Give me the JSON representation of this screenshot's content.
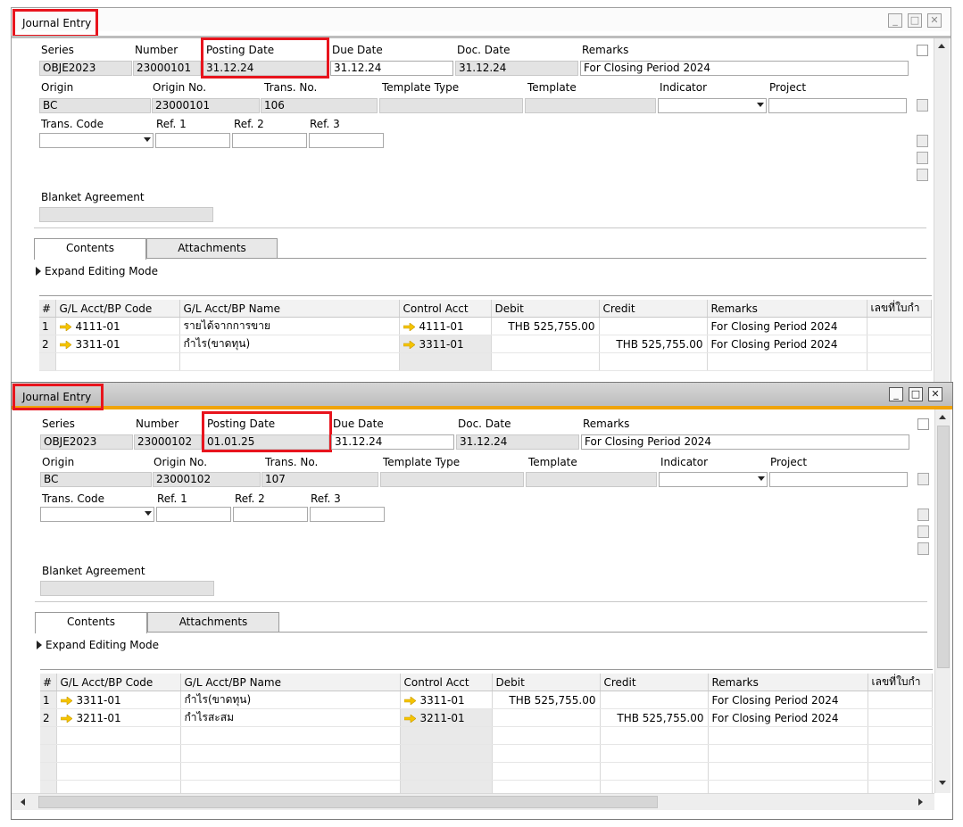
{
  "windows": [
    {
      "title": "Journal Entry",
      "fields": {
        "series": {
          "label": "Series",
          "value": "OBJE2023"
        },
        "number": {
          "label": "Number",
          "value": "23000101"
        },
        "posting_date": {
          "label": "Posting Date",
          "value": "31.12.24"
        },
        "due_date": {
          "label": "Due Date",
          "value": "31.12.24"
        },
        "doc_date": {
          "label": "Doc. Date",
          "value": "31.12.24"
        },
        "remarks": {
          "label": "Remarks",
          "value": "For Closing Period 2024"
        },
        "origin": {
          "label": "Origin",
          "value": "BC"
        },
        "origin_no": {
          "label": "Origin No.",
          "value": "23000101"
        },
        "trans_no": {
          "label": "Trans. No.",
          "value": "106"
        },
        "template_type": {
          "label": "Template Type",
          "value": ""
        },
        "template": {
          "label": "Template",
          "value": ""
        },
        "indicator": {
          "label": "Indicator",
          "value": ""
        },
        "project": {
          "label": "Project",
          "value": ""
        },
        "trans_code": {
          "label": "Trans. Code",
          "value": ""
        },
        "ref1": {
          "label": "Ref. 1",
          "value": ""
        },
        "ref2": {
          "label": "Ref. 2",
          "value": ""
        },
        "ref3": {
          "label": "Ref. 3",
          "value": ""
        },
        "blanket": {
          "label": "Blanket Agreement",
          "value": ""
        }
      },
      "tabs": [
        "Contents",
        "Attachments"
      ],
      "expand_label": "Expand Editing Mode",
      "columns": [
        "#",
        "G/L Acct/BP Code",
        "G/L Acct/BP Name",
        "Control Acct",
        "Debit",
        "Credit",
        "Remarks",
        "เลขที่ใบกำ"
      ],
      "rows": [
        {
          "n": "1",
          "code": "4111-01",
          "name": "รายได้จากการขาย",
          "ctrl": "4111-01",
          "debit": "THB 525,755.00",
          "credit": "",
          "remarks": "For Closing Period 2024"
        },
        {
          "n": "2",
          "code": "3311-01",
          "name": "กำไร(ขาดทุน)",
          "ctrl": "3311-01",
          "debit": "",
          "credit": "THB 525,755.00",
          "remarks": "For Closing Period 2024"
        }
      ]
    },
    {
      "title": "Journal Entry",
      "fields": {
        "series": {
          "label": "Series",
          "value": "OBJE2023"
        },
        "number": {
          "label": "Number",
          "value": "23000102"
        },
        "posting_date": {
          "label": "Posting Date",
          "value": "01.01.25"
        },
        "due_date": {
          "label": "Due Date",
          "value": "31.12.24"
        },
        "doc_date": {
          "label": "Doc. Date",
          "value": "31.12.24"
        },
        "remarks": {
          "label": "Remarks",
          "value": "For Closing Period 2024"
        },
        "origin": {
          "label": "Origin",
          "value": "BC"
        },
        "origin_no": {
          "label": "Origin No.",
          "value": "23000102"
        },
        "trans_no": {
          "label": "Trans. No.",
          "value": "107"
        },
        "template_type": {
          "label": "Template Type",
          "value": ""
        },
        "template": {
          "label": "Template",
          "value": ""
        },
        "indicator": {
          "label": "Indicator",
          "value": ""
        },
        "project": {
          "label": "Project",
          "value": ""
        },
        "trans_code": {
          "label": "Trans. Code",
          "value": ""
        },
        "ref1": {
          "label": "Ref. 1",
          "value": ""
        },
        "ref2": {
          "label": "Ref. 2",
          "value": ""
        },
        "ref3": {
          "label": "Ref. 3",
          "value": ""
        },
        "blanket": {
          "label": "Blanket Agreement",
          "value": ""
        }
      },
      "tabs": [
        "Contents",
        "Attachments"
      ],
      "expand_label": "Expand Editing Mode",
      "columns": [
        "#",
        "G/L Acct/BP Code",
        "G/L Acct/BP Name",
        "Control Acct",
        "Debit",
        "Credit",
        "Remarks",
        "เลขที่ใบกำ"
      ],
      "rows": [
        {
          "n": "1",
          "code": "3311-01",
          "name": "กำไร(ขาดทุน)",
          "ctrl": "3311-01",
          "debit": "THB 525,755.00",
          "credit": "",
          "remarks": "For Closing Period 2024"
        },
        {
          "n": "2",
          "code": "3211-01",
          "name": "กำไรสะสม",
          "ctrl": "3211-01",
          "debit": "",
          "credit": "THB 525,755.00",
          "remarks": "For Closing Period 2024"
        }
      ]
    }
  ],
  "colors": {
    "highlight": "#e8141d",
    "active_accent": "#f0a30a",
    "link_arrow": "#f5c400"
  },
  "icons": [
    "minimize-icon",
    "maximize-icon",
    "close-icon",
    "link-arrow-icon",
    "expand-triangle-icon",
    "scroll-up-icon",
    "scroll-down-icon",
    "scroll-left-icon",
    "scroll-right-icon"
  ]
}
